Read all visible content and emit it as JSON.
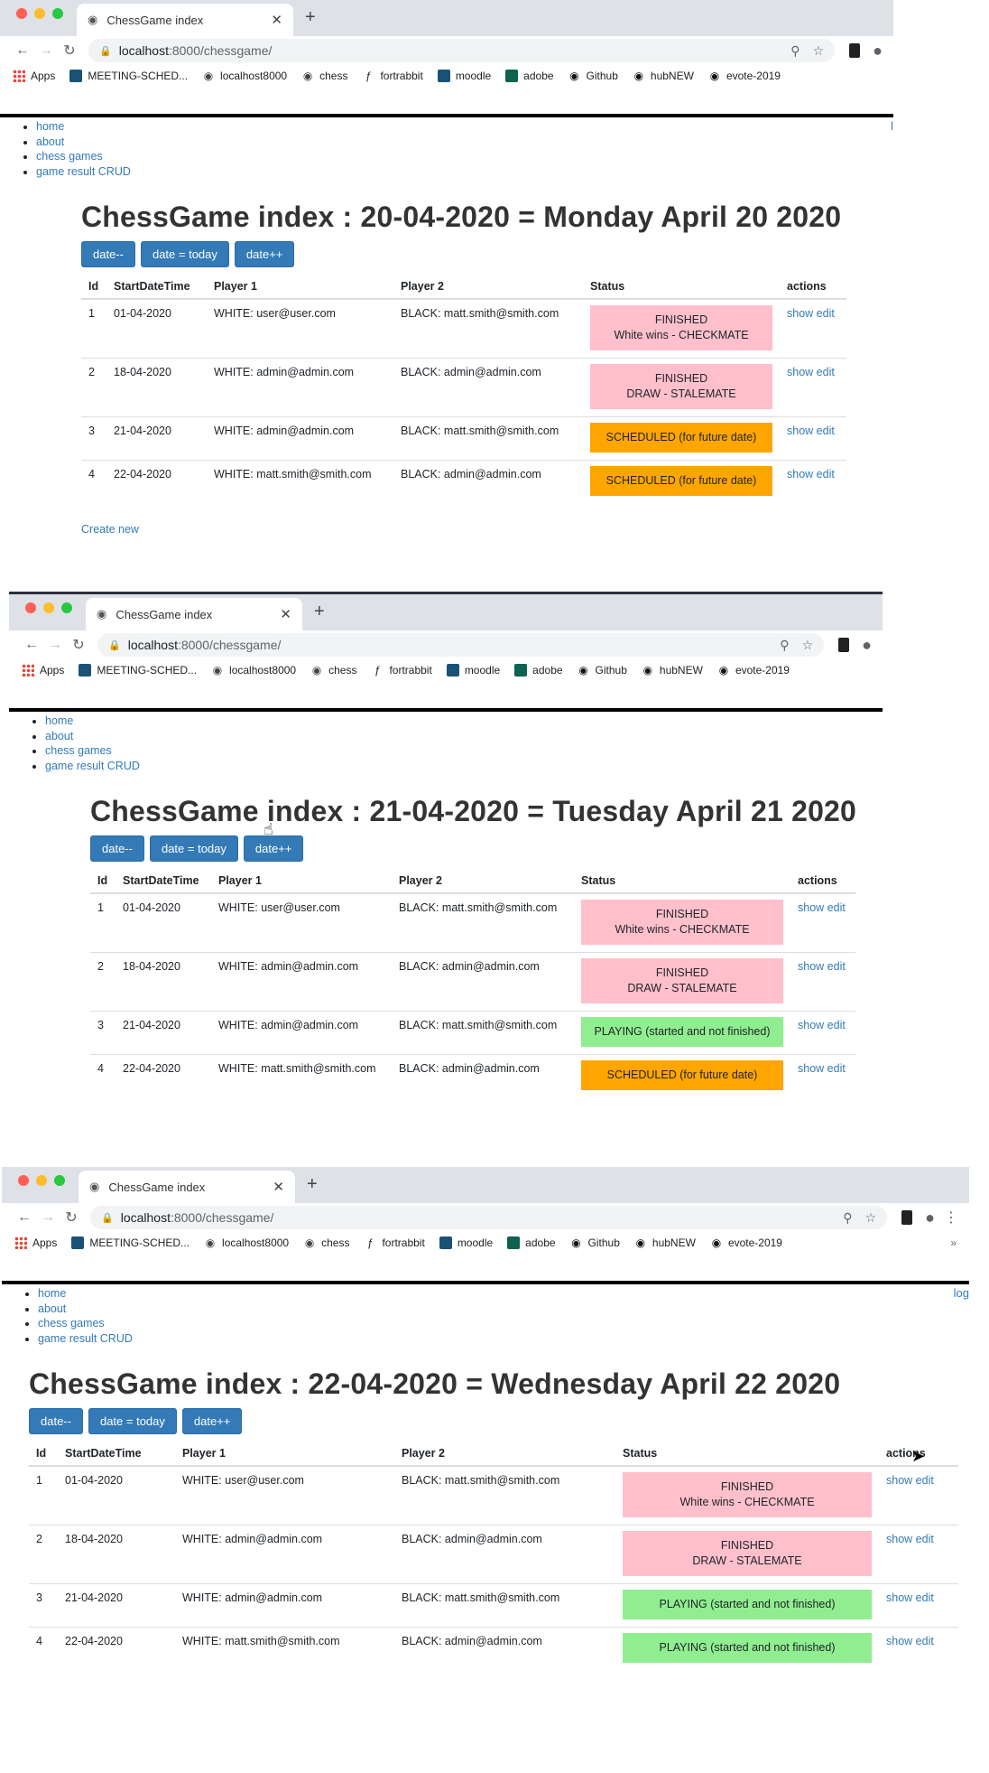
{
  "browser": {
    "tab_title": "ChessGame index",
    "url_host": "localhost",
    "url_path": ":8000/chessgame/",
    "bookmarks": [
      "Apps",
      "MEETING-SCHED...",
      "localhost8000",
      "chess",
      "fortrabbit",
      "moodle",
      "adobe",
      "Github",
      "hubNEW",
      "evote-2019"
    ],
    "bookmarks_more": "»"
  },
  "nav": [
    "home",
    "about",
    "chess games",
    "game result CRUD"
  ],
  "login_text_1": "l",
  "login_text_3": "log",
  "columns": [
    "Id",
    "StartDateTime",
    "Player 1",
    "Player 2",
    "Status",
    "actions"
  ],
  "buttons": {
    "prev": "date--",
    "today": "date = today",
    "next": "date++"
  },
  "create_new": "Create new",
  "shots": [
    {
      "title": "ChessGame index : 20-04-2020 = Monday April 20 2020",
      "rows": [
        {
          "id": "1",
          "start": "01-04-2020",
          "p1": "WHITE: user@user.com",
          "p2": "BLACK: matt.smith@smith.com",
          "status_line1": "FINISHED",
          "status_line2": "White wins - CHECKMATE",
          "status_kind": "finished",
          "show": "show",
          "edit": "edit"
        },
        {
          "id": "2",
          "start": "18-04-2020",
          "p1": "WHITE: admin@admin.com",
          "p2": "BLACK: admin@admin.com",
          "status_line1": "FINISHED",
          "status_line2": "DRAW - STALEMATE",
          "status_kind": "finished",
          "show": "show",
          "edit": "edit"
        },
        {
          "id": "3",
          "start": "21-04-2020",
          "p1": "WHITE: admin@admin.com",
          "p2": "BLACK: matt.smith@smith.com",
          "status_line1": "SCHEDULED (for future date)",
          "status_line2": "",
          "status_kind": "scheduled",
          "show": "show",
          "edit": "edit"
        },
        {
          "id": "4",
          "start": "22-04-2020",
          "p1": "WHITE: matt.smith@smith.com",
          "p2": "BLACK: admin@admin.com",
          "status_line1": "SCHEDULED (for future date)",
          "status_line2": "",
          "status_kind": "scheduled",
          "show": "show",
          "edit": "edit"
        }
      ]
    },
    {
      "title": "ChessGame index : 21-04-2020 = Tuesday April 21 2020",
      "rows": [
        {
          "id": "1",
          "start": "01-04-2020",
          "p1": "WHITE: user@user.com",
          "p2": "BLACK: matt.smith@smith.com",
          "status_line1": "FINISHED",
          "status_line2": "White wins - CHECKMATE",
          "status_kind": "finished",
          "show": "show",
          "edit": "edit"
        },
        {
          "id": "2",
          "start": "18-04-2020",
          "p1": "WHITE: admin@admin.com",
          "p2": "BLACK: admin@admin.com",
          "status_line1": "FINISHED",
          "status_line2": "DRAW - STALEMATE",
          "status_kind": "finished",
          "show": "show",
          "edit": "edit"
        },
        {
          "id": "3",
          "start": "21-04-2020",
          "p1": "WHITE: admin@admin.com",
          "p2": "BLACK: matt.smith@smith.com",
          "status_line1": "PLAYING (started and not finished)",
          "status_line2": "",
          "status_kind": "playing",
          "show": "show",
          "edit": "edit"
        },
        {
          "id": "4",
          "start": "22-04-2020",
          "p1": "WHITE: matt.smith@smith.com",
          "p2": "BLACK: admin@admin.com",
          "status_line1": "SCHEDULED (for future date)",
          "status_line2": "",
          "status_kind": "scheduled",
          "show": "show",
          "edit": "edit"
        }
      ]
    },
    {
      "title": "ChessGame index : 22-04-2020 = Wednesday April 22 2020",
      "rows": [
        {
          "id": "1",
          "start": "01-04-2020",
          "p1": "WHITE: user@user.com",
          "p2": "BLACK: matt.smith@smith.com",
          "status_line1": "FINISHED",
          "status_line2": "White wins - CHECKMATE",
          "status_kind": "finished",
          "show": "show",
          "edit": "edit"
        },
        {
          "id": "2",
          "start": "18-04-2020",
          "p1": "WHITE: admin@admin.com",
          "p2": "BLACK: admin@admin.com",
          "status_line1": "FINISHED",
          "status_line2": "DRAW - STALEMATE",
          "status_kind": "finished",
          "show": "show",
          "edit": "edit"
        },
        {
          "id": "3",
          "start": "21-04-2020",
          "p1": "WHITE: admin@admin.com",
          "p2": "BLACK: matt.smith@smith.com",
          "status_line1": "PLAYING (started and not finished)",
          "status_line2": "",
          "status_kind": "playing",
          "show": "show",
          "edit": "edit"
        },
        {
          "id": "4",
          "start": "22-04-2020",
          "p1": "WHITE: matt.smith@smith.com",
          "p2": "BLACK: admin@admin.com",
          "status_line1": "PLAYING (started and not finished)",
          "status_line2": "",
          "status_kind": "playing",
          "show": "show",
          "edit": "edit"
        }
      ]
    }
  ]
}
